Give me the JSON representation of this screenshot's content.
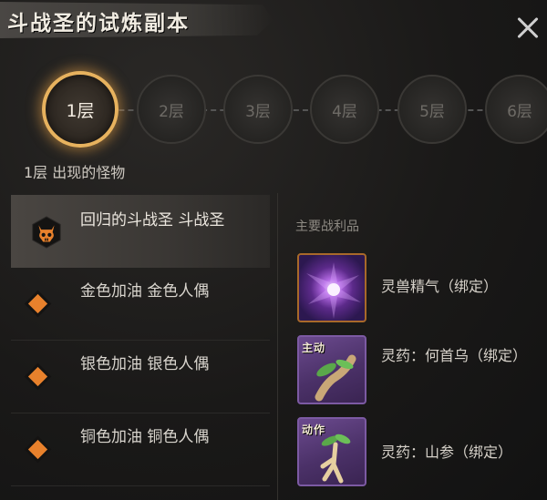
{
  "header": {
    "title": "斗战圣的试炼副本",
    "close_icon": "close-icon"
  },
  "floors": {
    "nodes": [
      {
        "label": "1层",
        "active": true
      },
      {
        "label": "2层",
        "active": false
      },
      {
        "label": "3层",
        "active": false
      },
      {
        "label": "4层",
        "active": false
      },
      {
        "label": "5层",
        "active": false
      },
      {
        "label": "6层",
        "active": false
      }
    ],
    "current_label": "1层 出现的怪物"
  },
  "monsters": [
    {
      "name": "回归的斗战圣 斗战圣",
      "icon": "boss-skull-icon",
      "selected": true
    },
    {
      "name": "金色加油 金色人偶",
      "icon": "orange-diamond-icon",
      "selected": false
    },
    {
      "name": "银色加油 银色人偶",
      "icon": "orange-diamond-icon",
      "selected": false
    },
    {
      "name": "铜色加油 铜色人偶",
      "icon": "orange-diamond-icon",
      "selected": false
    }
  ],
  "loot": {
    "header": "主要战利品",
    "items": [
      {
        "name": "灵兽精气（绑定）",
        "tag": ""
      },
      {
        "name": "灵药：何首乌（绑定）",
        "tag": "主动"
      },
      {
        "name": "灵药：山参（绑定）",
        "tag": "动作"
      }
    ]
  },
  "colors": {
    "accent": "#e7b25e",
    "diamond": "#e8812c",
    "background": "#1a1918"
  }
}
